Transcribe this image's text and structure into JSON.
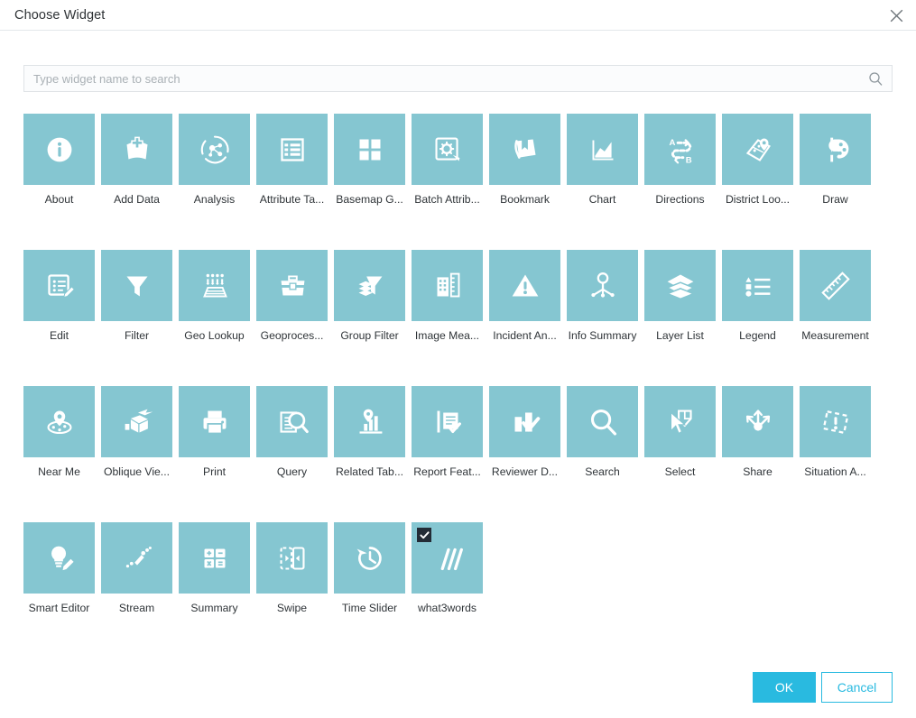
{
  "dialog": {
    "title": "Choose Widget",
    "close_icon": "close-icon"
  },
  "search": {
    "placeholder": "Type widget name to search",
    "value": "",
    "icon": "search-icon"
  },
  "widgets": [
    {
      "label": "About",
      "icon": "info-circle-icon",
      "selected": false
    },
    {
      "label": "Add Data",
      "icon": "add-data-icon",
      "selected": false
    },
    {
      "label": "Analysis",
      "icon": "analysis-icon",
      "selected": false
    },
    {
      "label": "Attribute Ta...",
      "icon": "attribute-table-icon",
      "selected": false
    },
    {
      "label": "Basemap G...",
      "icon": "basemap-gallery-icon",
      "selected": false
    },
    {
      "label": "Batch Attrib...",
      "icon": "batch-attribute-icon",
      "selected": false
    },
    {
      "label": "Bookmark",
      "icon": "bookmark-icon",
      "selected": false
    },
    {
      "label": "Chart",
      "icon": "chart-icon",
      "selected": false
    },
    {
      "label": "Directions",
      "icon": "directions-icon",
      "selected": false
    },
    {
      "label": "District Loo...",
      "icon": "district-lookup-icon",
      "selected": false
    },
    {
      "label": "Draw",
      "icon": "draw-palette-icon",
      "selected": false
    },
    {
      "label": "Edit",
      "icon": "edit-icon",
      "selected": false
    },
    {
      "label": "Filter",
      "icon": "filter-icon",
      "selected": false
    },
    {
      "label": "Geo Lookup",
      "icon": "geo-lookup-icon",
      "selected": false
    },
    {
      "label": "Geoproces...",
      "icon": "geoprocessing-icon",
      "selected": false
    },
    {
      "label": "Group Filter",
      "icon": "group-filter-icon",
      "selected": false
    },
    {
      "label": "Image Mea...",
      "icon": "image-measurement-icon",
      "selected": false
    },
    {
      "label": "Incident An...",
      "icon": "incident-analysis-icon",
      "selected": false
    },
    {
      "label": "Info Summary",
      "icon": "info-summary-icon",
      "selected": false
    },
    {
      "label": "Layer List",
      "icon": "layer-list-icon",
      "selected": false
    },
    {
      "label": "Legend",
      "icon": "legend-icon",
      "selected": false
    },
    {
      "label": "Measurement",
      "icon": "measurement-ruler-icon",
      "selected": false
    },
    {
      "label": "Near Me",
      "icon": "near-me-icon",
      "selected": false
    },
    {
      "label": "Oblique Vie...",
      "icon": "oblique-viewer-icon",
      "selected": false
    },
    {
      "label": "Print",
      "icon": "print-icon",
      "selected": false
    },
    {
      "label": "Query",
      "icon": "query-icon",
      "selected": false
    },
    {
      "label": "Related Tab...",
      "icon": "related-table-icon",
      "selected": false
    },
    {
      "label": "Report Feat...",
      "icon": "report-feature-icon",
      "selected": false
    },
    {
      "label": "Reviewer D...",
      "icon": "reviewer-dashboard-icon",
      "selected": false
    },
    {
      "label": "Search",
      "icon": "search-magnifier-icon",
      "selected": false
    },
    {
      "label": "Select",
      "icon": "select-icon",
      "selected": false
    },
    {
      "label": "Share",
      "icon": "share-icon",
      "selected": false
    },
    {
      "label": "Situation A...",
      "icon": "situation-awareness-icon",
      "selected": false
    },
    {
      "label": "Smart Editor",
      "icon": "smart-editor-icon",
      "selected": false
    },
    {
      "label": "Stream",
      "icon": "stream-icon",
      "selected": false
    },
    {
      "label": "Summary",
      "icon": "summary-calculator-icon",
      "selected": false
    },
    {
      "label": "Swipe",
      "icon": "swipe-icon",
      "selected": false
    },
    {
      "label": "Time Slider",
      "icon": "time-slider-icon",
      "selected": false
    },
    {
      "label": "what3words",
      "icon": "what3words-icon",
      "selected": true
    }
  ],
  "footer": {
    "ok_label": "OK",
    "cancel_label": "Cancel"
  },
  "colors": {
    "tile": "#85c6d1",
    "accent": "#29bae0",
    "checkbox": "#232c36",
    "text": "#2f3438"
  }
}
